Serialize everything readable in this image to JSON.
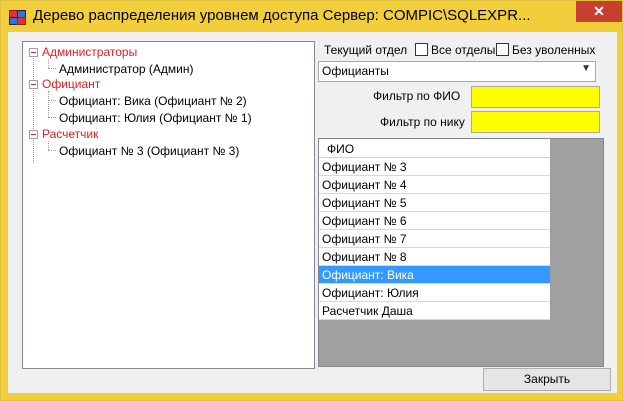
{
  "window": {
    "title": "Дерево распределения уровнем доступа  Сервер: COMPIC\\SQLEXPR...",
    "close_glyph": "✕"
  },
  "tree": {
    "groups": [
      {
        "label": "Администраторы",
        "children": [
          "Администратор   (Админ)"
        ]
      },
      {
        "label": "Официант",
        "children": [
          "Официант: Вика  (Официант № 2)",
          "Официант: Юлия  (Официант № 1)"
        ]
      },
      {
        "label": "Расчетчик",
        "children": [
          "Официант № 3 (Официант № 3)"
        ]
      }
    ]
  },
  "filters": {
    "department_label": "Текущий отдел",
    "all_departments_label": "Все отделы",
    "all_departments_checked": false,
    "without_fired_label": "Без уволенных",
    "without_fired_checked": false,
    "department_value": "Официанты",
    "fio_filter_label": "Фильтр по ФИО",
    "fio_filter_value": "",
    "nick_filter_label": "Фильтр по нику",
    "nick_filter_value": ""
  },
  "grid": {
    "header": "ФИО",
    "rows": [
      "Официант № 3",
      "Официант № 4",
      "Официант № 5",
      "Официант № 6",
      "Официант № 7",
      "Официант № 8",
      "Официант: Вика",
      "Официант: Юлия",
      "Расчетчик Даша"
    ],
    "selected_index": 6
  },
  "buttons": {
    "close_label": "Закрыть"
  },
  "colors": {
    "title_bar": "#f2ce3a",
    "close_button": "#c7402f",
    "group_text": "#e02020",
    "filter_input": "#ffff00",
    "selection": "#3399ff"
  }
}
